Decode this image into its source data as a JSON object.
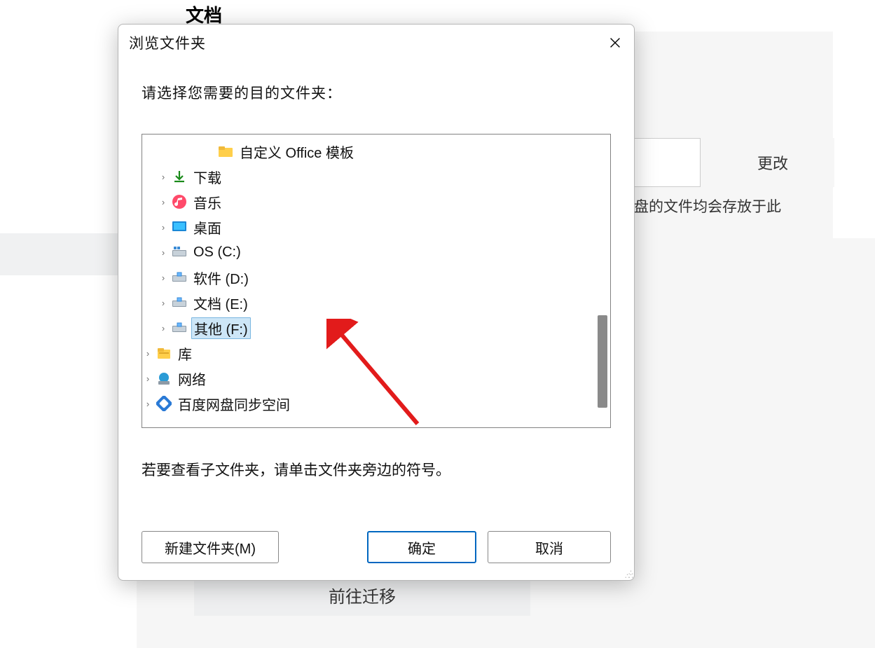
{
  "bg": {
    "title": "文档",
    "change_btn": "更改",
    "hint_text": "盘的文件均会存放于此",
    "migrate_btn": "前往迁移"
  },
  "dialog": {
    "title": "浏览文件夹",
    "prompt": "请选择您需要的目的文件夹：",
    "hint": "若要查看子文件夹，请单击文件夹旁边的符号。",
    "new_folder_btn": "新建文件夹(M)",
    "ok_btn": "确定",
    "cancel_btn": "取消"
  },
  "tree": [
    {
      "indent": "indent2",
      "expand": "",
      "icon": "folder",
      "label": "自定义 Office 模板",
      "selected": false,
      "name": "tree-item-office-templates"
    },
    {
      "indent": "indent1",
      "expand": "›",
      "icon": "download",
      "label": "下载",
      "selected": false,
      "name": "tree-item-downloads"
    },
    {
      "indent": "indent1",
      "expand": "›",
      "icon": "music",
      "label": "音乐",
      "selected": false,
      "name": "tree-item-music"
    },
    {
      "indent": "indent1",
      "expand": "›",
      "icon": "monitor",
      "label": "桌面",
      "selected": false,
      "name": "tree-item-desktop"
    },
    {
      "indent": "indent1",
      "expand": "›",
      "icon": "drive-os",
      "label": "OS (C:)",
      "selected": false,
      "name": "tree-item-drive-c"
    },
    {
      "indent": "indent1",
      "expand": "›",
      "icon": "drive",
      "label": "软件 (D:)",
      "selected": false,
      "name": "tree-item-drive-d"
    },
    {
      "indent": "indent1",
      "expand": "›",
      "icon": "drive",
      "label": "文档 (E:)",
      "selected": false,
      "name": "tree-item-drive-e"
    },
    {
      "indent": "indent1",
      "expand": "›",
      "icon": "drive",
      "label": "其他 (F:)",
      "selected": true,
      "name": "tree-item-drive-f"
    },
    {
      "indent": "",
      "expand": "›",
      "icon": "lib",
      "label": "库",
      "selected": false,
      "name": "tree-item-libraries"
    },
    {
      "indent": "",
      "expand": "›",
      "icon": "network",
      "label": "网络",
      "selected": false,
      "name": "tree-item-network"
    },
    {
      "indent": "",
      "expand": "›",
      "icon": "sync",
      "label": "百度网盘同步空间",
      "selected": false,
      "name": "tree-item-baidu-sync"
    }
  ]
}
